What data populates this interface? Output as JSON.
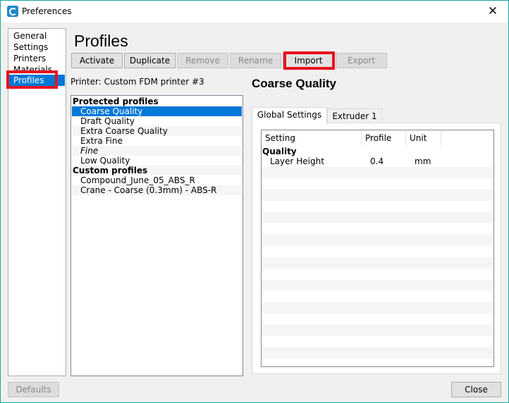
{
  "window": {
    "title": "Preferences",
    "app_icon": "cura-icon",
    "close_icon": "close-icon",
    "close_glyph": "✕"
  },
  "nav": {
    "items": [
      {
        "label": "General"
      },
      {
        "label": "Settings"
      },
      {
        "label": "Printers"
      },
      {
        "label": "Materials"
      },
      {
        "label": "Profiles",
        "selected": true
      }
    ]
  },
  "heading": "Profiles",
  "toolbar": {
    "activate": "Activate",
    "duplicate": "Duplicate",
    "remove": "Remove",
    "rename": "Rename",
    "import": "Import",
    "export": "Export"
  },
  "printer_label": "Printer: Custom FDM printer #3",
  "profiles": {
    "protected_header": "Protected profiles",
    "protected": [
      {
        "label": "Coarse Quality",
        "selected": true
      },
      {
        "label": "Draft Quality"
      },
      {
        "label": "Extra Coarse Quality"
      },
      {
        "label": "Extra Fine"
      },
      {
        "label": "Fine",
        "italic": true
      },
      {
        "label": "Low Quality"
      }
    ],
    "custom_header": "Custom profiles",
    "custom": [
      {
        "label": "Compound_June_05_ABS_R"
      },
      {
        "label": "Crane - Coarse (0.3mm) - ABS-R"
      }
    ]
  },
  "detail": {
    "title": "Coarse Quality",
    "tabs": [
      {
        "label": "Global Settings",
        "active": true
      },
      {
        "label": "Extruder 1"
      }
    ],
    "table": {
      "headers": [
        "Setting",
        "Profile",
        "Unit"
      ],
      "group": "Quality",
      "rows": [
        {
          "setting": "Layer Height",
          "profile": "0.4",
          "unit": "mm"
        }
      ]
    }
  },
  "footer": {
    "defaults": "Defaults",
    "close": "Close"
  },
  "colors": {
    "selection": "#0078d7",
    "highlight_box": "#e8121f",
    "window_border": "#1aa3a3"
  }
}
